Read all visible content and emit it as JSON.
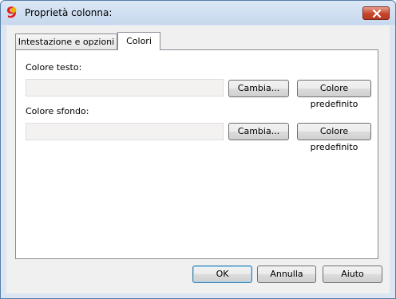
{
  "window": {
    "title": "Proprietà colonna:",
    "app_icon": "banana-9-icon",
    "close_icon": "close-icon"
  },
  "tabs": [
    {
      "label": "Intestazione e opzioni",
      "selected": false
    },
    {
      "label": "Colori",
      "selected": true
    }
  ],
  "text_color": {
    "label": "Colore testo:",
    "change_label": "Cambia...",
    "default_label": "Colore predefinito"
  },
  "background_color": {
    "label": "Colore sfondo:",
    "change_label": "Cambia...",
    "default_label": "Colore predefinito"
  },
  "footer": {
    "ok_label": "OK",
    "cancel_label": "Annulla",
    "help_label": "Aiuto"
  }
}
